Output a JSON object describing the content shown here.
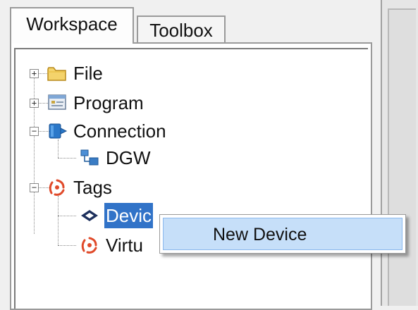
{
  "tabs": [
    {
      "label": "Workspace",
      "active": true
    },
    {
      "label": "Toolbox",
      "active": false
    }
  ],
  "tree": {
    "file": {
      "label": "File",
      "expander": "+",
      "icon": "folder-icon"
    },
    "program": {
      "label": "Program",
      "expander": "+",
      "icon": "program-icon"
    },
    "connection": {
      "label": "Connection",
      "expander": "−",
      "icon": "connection-icon",
      "children": {
        "dgw": {
          "label": "DGW",
          "icon": "network-device-icon"
        }
      }
    },
    "tags": {
      "label": "Tags",
      "expander": "−",
      "icon": "tags-icon",
      "children": {
        "device": {
          "label": "Devic",
          "icon": "device-tag-icon",
          "selected": true
        },
        "virtual": {
          "label": "Virtu",
          "icon": "virtual-tag-icon"
        }
      }
    }
  },
  "context_menu": {
    "items": [
      {
        "label": "New Device",
        "highlighted": true
      }
    ]
  },
  "colors": {
    "selection": "#3173c8",
    "menu_highlight": "#c6dff9",
    "tags_icon": "#e04a2a"
  }
}
